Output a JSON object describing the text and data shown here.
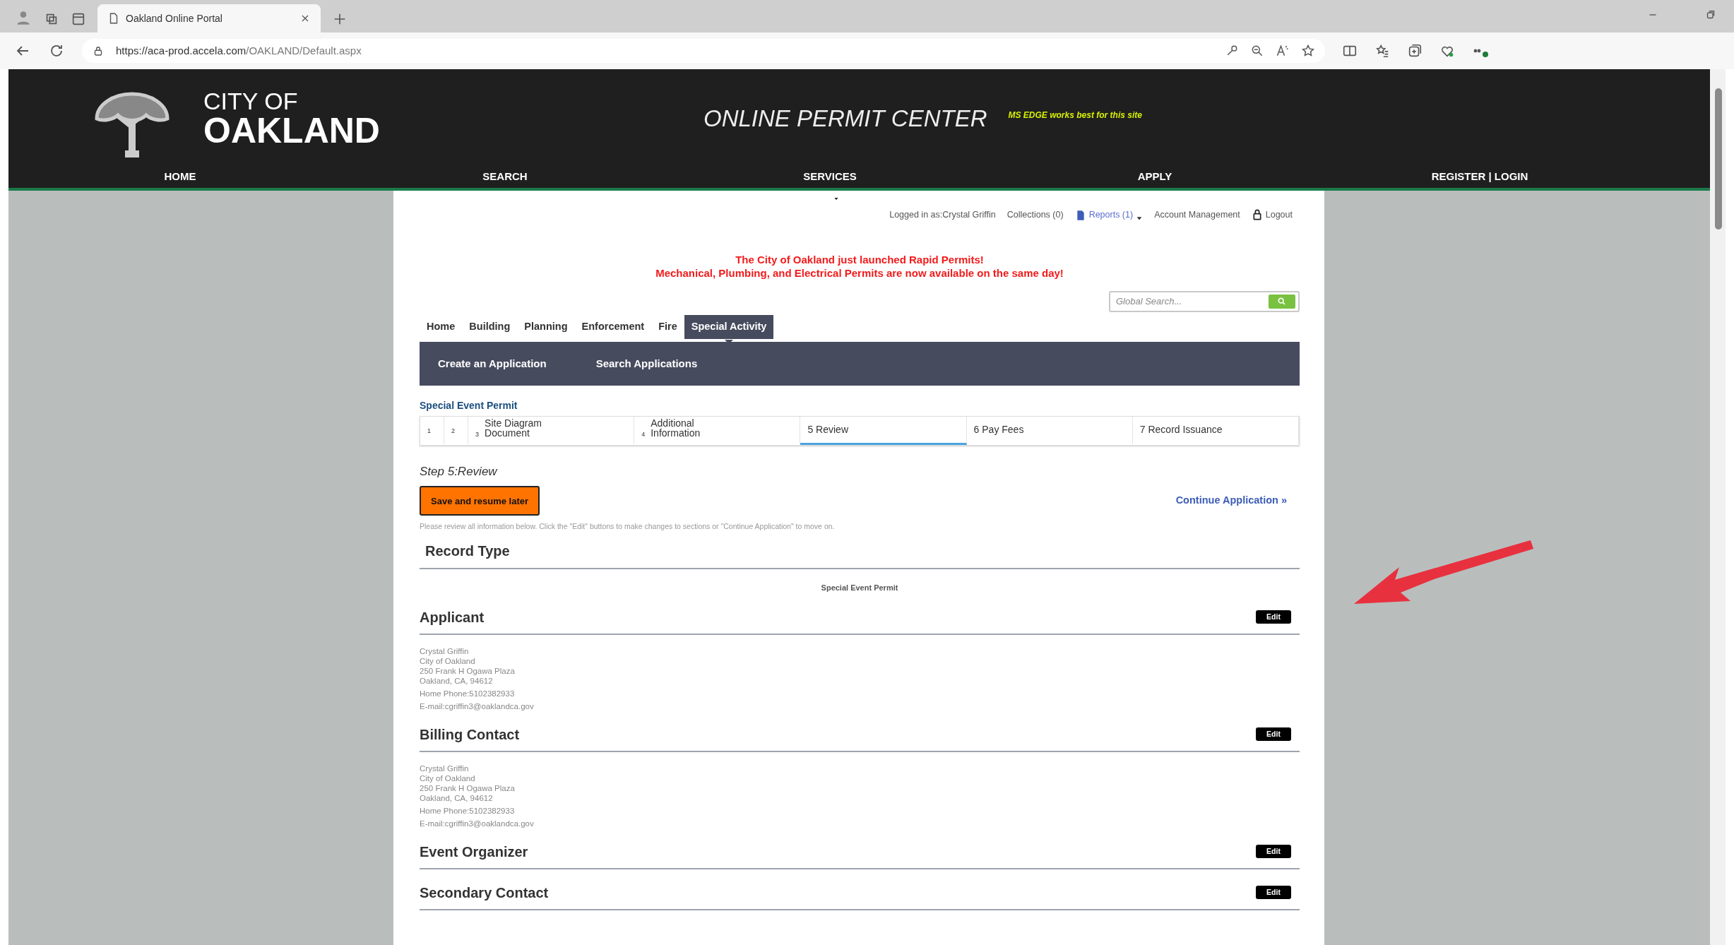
{
  "browser": {
    "tab_title": "Oakland Online Portal",
    "url_host": "https://aca-prod.accela.com",
    "url_path": "/OAKLAND/Default.aspx"
  },
  "header": {
    "logo_line1": "CITY OF",
    "logo_line2": "OAKLAND",
    "title": "ONLINE PERMIT CENTER",
    "note": "MS EDGE works best for this site",
    "nav": [
      "HOME",
      "SEARCH",
      "SERVICES",
      "APPLY",
      "REGISTER | LOGIN"
    ]
  },
  "user_bar": {
    "logged_in": "Logged in as:Crystal Griffin",
    "collections": "Collections (0)",
    "reports": "Reports (1)",
    "account": "Account Management",
    "logout": "Logout"
  },
  "announcement": [
    "The City of Oakland just launched Rapid Permits!",
    "Mechanical, Plumbing, and Electrical Permits are now available on the same day!"
  ],
  "global_search": {
    "placeholder": "Global Search..."
  },
  "tabs": [
    {
      "label": "Home",
      "selected": false
    },
    {
      "label": "Building",
      "selected": false
    },
    {
      "label": "Planning",
      "selected": false
    },
    {
      "label": "Enforcement",
      "selected": false
    },
    {
      "label": "Fire",
      "selected": false
    },
    {
      "label": "Special Activity",
      "selected": true
    }
  ],
  "subnav": [
    "Create an Application",
    "Search Applications"
  ],
  "permit_title": "Special Event Permit",
  "steps": [
    {
      "number": "1",
      "compact": true,
      "selected": false
    },
    {
      "number": "2",
      "compact": true,
      "selected": false
    },
    {
      "number": "3",
      "label": "Site Diagram Document",
      "compact": true,
      "selected": false
    },
    {
      "number": "4",
      "label": "Additional Information",
      "compact": true,
      "selected": false
    },
    {
      "number": "5",
      "label": "Review",
      "compact": false,
      "selected": true
    },
    {
      "number": "6",
      "label": "Pay Fees",
      "compact": false,
      "selected": false
    },
    {
      "number": "7",
      "label": "Record Issuance",
      "compact": false,
      "selected": false
    }
  ],
  "step_title": "Step 5:Review",
  "save_button": "Save and resume later",
  "continue_link": "Continue Application »",
  "instructions": "Please review all information below. Click the \"Edit\" buttons to make changes to sections or \"Continue Application\" to move on.",
  "sections": [
    {
      "kind": "record_type",
      "title": "Record Type",
      "value": "Special Event Permit"
    },
    {
      "kind": "contact",
      "title": "Applicant",
      "edit": "Edit",
      "lines": [
        "Crystal Griffin",
        "City of Oakland",
        "250 Frank H Ogawa Plaza",
        "Oakland, CA, 94612"
      ],
      "phone": "Home Phone:5102382933",
      "email": "E-mail:cgriffin3@oaklandca.gov"
    },
    {
      "kind": "contact",
      "title": "Billing Contact",
      "edit": "Edit",
      "lines": [
        "Crystal Griffin",
        "City of Oakland",
        "250 Frank H Ogawa Plaza",
        "Oakland, CA, 94612"
      ],
      "phone": "Home Phone:5102382933",
      "email": "E-mail:cgriffin3@oaklandca.gov"
    },
    {
      "kind": "contact",
      "title": "Event Organizer",
      "edit": "Edit"
    },
    {
      "kind": "contact",
      "title": "Secondary Contact",
      "edit": "Edit"
    }
  ]
}
